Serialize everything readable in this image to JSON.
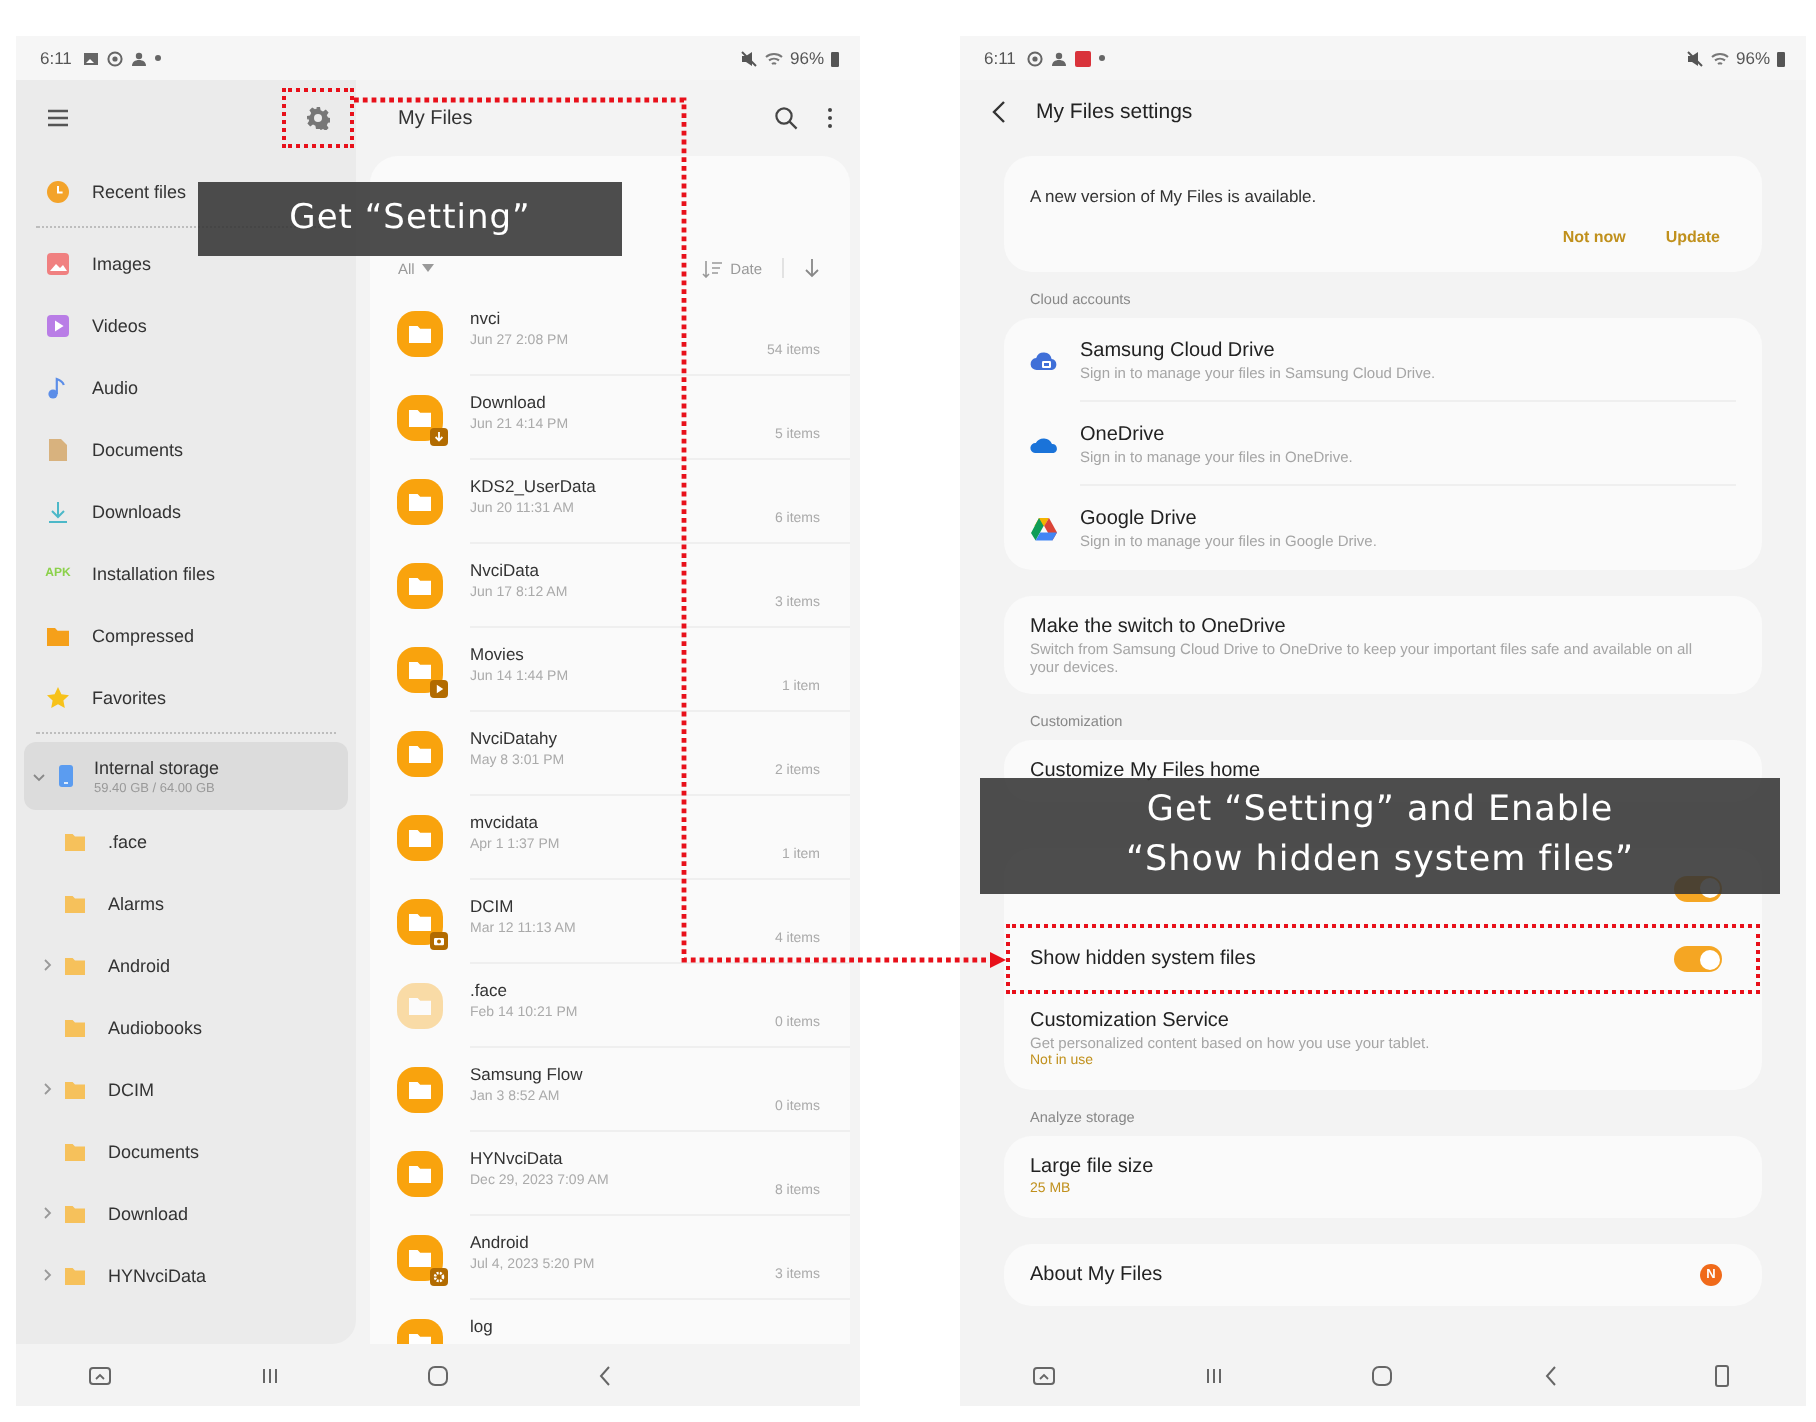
{
  "annotations": [
    {
      "lines": [
        "Get “Setting”"
      ]
    },
    {
      "lines": [
        "Get “Setting” and Enable",
        "“Show hidden system files”"
      ]
    }
  ],
  "left_screen": {
    "status_bar": {
      "time": "6:11",
      "battery": "96%"
    },
    "toolbar": {
      "title": "My Files",
      "settings_highlighted": true
    },
    "sidebar": {
      "items": [
        {
          "label": "Recent files",
          "selected": false
        },
        {
          "label": "Images",
          "selected": false
        },
        {
          "label": "Videos",
          "selected": false
        },
        {
          "label": "Audio",
          "selected": false
        },
        {
          "label": "Documents",
          "selected": false
        },
        {
          "label": "Downloads",
          "selected": false
        },
        {
          "label": "Installation files",
          "icon_text": "APK",
          "selected": false
        },
        {
          "label": "Compressed",
          "selected": false
        },
        {
          "label": "Favorites",
          "selected": false
        }
      ],
      "storage": {
        "label": "Internal storage",
        "usage": "59.40 GB / 64.00 GB",
        "selected": true,
        "expanded": true,
        "children": [
          {
            "label": ".face",
            "has_subfolders": false,
            "selected": false
          },
          {
            "label": "Alarms",
            "has_subfolders": false,
            "selected": false
          },
          {
            "label": "Android",
            "has_subfolders": true,
            "selected": false
          },
          {
            "label": "Audiobooks",
            "has_subfolders": false,
            "selected": false
          },
          {
            "label": "DCIM",
            "has_subfolders": true,
            "selected": false
          },
          {
            "label": "Documents",
            "has_subfolders": false,
            "selected": false
          },
          {
            "label": "Download",
            "has_subfolders": true,
            "selected": false
          },
          {
            "label": "HYNvciData",
            "has_subfolders": true,
            "selected": false
          }
        ]
      }
    },
    "file_list": {
      "filter": "All",
      "sort": "Date",
      "rows": [
        {
          "name": "nvci",
          "date": "Jun 27 2:08 PM",
          "count": "54 items",
          "kind": "plain",
          "hidden": false
        },
        {
          "name": "Download",
          "date": "Jun 21 4:14 PM",
          "count": "5 items",
          "kind": "download",
          "hidden": false
        },
        {
          "name": "KDS2_UserData",
          "date": "Jun 20 11:31 AM",
          "count": "6 items",
          "kind": "plain",
          "hidden": false
        },
        {
          "name": "NvciData",
          "date": "Jun 17 8:12 AM",
          "count": "3 items",
          "kind": "plain",
          "hidden": false
        },
        {
          "name": "Movies",
          "date": "Jun 14 1:44 PM",
          "count": "1 item",
          "kind": "video",
          "hidden": false
        },
        {
          "name": "NvciDatahy",
          "date": "May 8 3:01 PM",
          "count": "2 items",
          "kind": "plain",
          "hidden": false
        },
        {
          "name": "mvcidata",
          "date": "Apr 1 1:37 PM",
          "count": "1 item",
          "kind": "plain",
          "hidden": false
        },
        {
          "name": "DCIM",
          "date": "Mar 12 11:13 AM",
          "count": "4 items",
          "kind": "camera",
          "hidden": false
        },
        {
          "name": ".face",
          "date": "Feb 14 10:21 PM",
          "count": "0 items",
          "kind": "plain",
          "hidden": true
        },
        {
          "name": "Samsung Flow",
          "date": "Jan 3 8:52 AM",
          "count": "0 items",
          "kind": "plain",
          "hidden": false
        },
        {
          "name": "HYNvciData",
          "date": "Dec 29, 2023 7:09 AM",
          "count": "8 items",
          "kind": "plain",
          "hidden": false
        },
        {
          "name": "Android",
          "date": "Jul 4, 2023 5:20 PM",
          "count": "3 items",
          "kind": "system",
          "hidden": false
        },
        {
          "name": "log",
          "kind": "plain",
          "hidden": false
        }
      ]
    }
  },
  "right_screen": {
    "status_bar": {
      "time": "6:11",
      "battery": "96%"
    },
    "header": {
      "title": "My Files settings"
    },
    "sections": [
      {
        "rows": [
          {
            "kind": "notice",
            "title": "A new version of My Files is available.",
            "actions": [
              "Not now",
              "Update"
            ]
          }
        ]
      },
      {
        "header": "Cloud accounts",
        "rows": [
          {
            "kind": "account",
            "title": "Samsung Cloud Drive",
            "subtitle": "Sign in to manage your files in Samsung Cloud Drive."
          },
          {
            "kind": "account",
            "title": "OneDrive",
            "subtitle": "Sign in to manage your files in OneDrive."
          },
          {
            "kind": "account",
            "title": "Google Drive",
            "subtitle": "Sign in to manage your files in Google Drive."
          }
        ]
      },
      {
        "rows": [
          {
            "kind": "text",
            "title": "Make the switch to OneDrive",
            "subtitle": "Switch from Samsung Cloud Drive to OneDrive to keep your important files safe and available on all your devices."
          }
        ]
      },
      {
        "header": "Customization",
        "rows": [
          {
            "kind": "text",
            "title": "Customize My Files home"
          }
        ]
      },
      {
        "rows": [
          {
            "kind": "toggle",
            "on": true,
            "highlighted": false
          },
          {
            "kind": "toggle",
            "title": "Show hidden system files",
            "on": true,
            "highlighted": true
          },
          {
            "kind": "text",
            "title": "Customization Service",
            "subtitle": "Get personalized content based on how you use your tablet.",
            "status": "Not in use"
          }
        ]
      },
      {
        "header": "Analyze storage",
        "rows": [
          {
            "kind": "text",
            "title": "Large file size",
            "status": "25 MB"
          }
        ]
      },
      {
        "rows": [
          {
            "kind": "badge",
            "title": "About My Files",
            "badge": "N"
          }
        ]
      }
    ]
  }
}
